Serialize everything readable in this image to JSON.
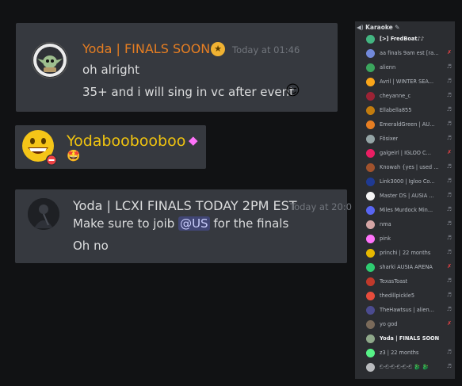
{
  "messages": [
    {
      "author": "Yoda | FINALS SOON",
      "badge": "★",
      "timestamp": "Today at 01:46",
      "lines": [
        "oh alright",
        "35+ and i will sing in vc after event"
      ],
      "emoji": "😏",
      "name_color": "#e67e22"
    },
    {
      "author": "Yodaboobooboo",
      "badge": "◆",
      "emoji_line": "🤩",
      "name_color": "#f1c40f"
    },
    {
      "author": "Yoda | LCXI FINALS TODAY 2PM EST",
      "timestamp": "Today at 20:0",
      "line1_prefix": "Make sure to joib ",
      "mention": "@US",
      "line1_suffix": " for the finals",
      "line2": "Oh no",
      "name_color": "#dcddde"
    }
  ],
  "voice_channel": {
    "name": "Karaoke",
    "icon": "speaker-icon",
    "members": [
      {
        "name": "[>] FredBoat♪♪",
        "color": "#43b581",
        "status": "",
        "highlight": true
      },
      {
        "name": "aa finals 9am est [ra...",
        "color": "#7289da",
        "status": "muted"
      },
      {
        "name": "alienn",
        "color": "#3ba55d",
        "status": "deafened"
      },
      {
        "name": "Avril | WINTER SEA...",
        "color": "#faa61a",
        "status": "deafened"
      },
      {
        "name": "cheyanne_c",
        "color": "#9b2335",
        "status": "deafened"
      },
      {
        "name": "Ellabella855",
        "color": "#c27c0e",
        "status": "deafened"
      },
      {
        "name": "EmeraldGreen | AU...",
        "color": "#e67e22",
        "status": "deafened"
      },
      {
        "name": "Fösixer",
        "color": "#95a5a6",
        "status": "deafened"
      },
      {
        "name": "galgeirl | IGLOO C...",
        "color": "#e91e63",
        "status": "muted"
      },
      {
        "name": "Knowah {yes | used ...",
        "color": "#a0522d",
        "status": "deafened"
      },
      {
        "name": "Link3000 | Igloo Co...",
        "color": "#1f3a93",
        "status": "deafened"
      },
      {
        "name": "Master DS | AUSIA ...",
        "color": "#f4f4f4",
        "status": "deafened"
      },
      {
        "name": "Miles Murdock Min...",
        "color": "#5865f2",
        "status": "deafened"
      },
      {
        "name": "nma",
        "color": "#d4a5a5",
        "status": "deafened"
      },
      {
        "name": "pink",
        "color": "#ff73fa",
        "status": "deafened"
      },
      {
        "name": "princhi | 22 months",
        "color": "#e6b800",
        "status": "deafened"
      },
      {
        "name": "sharki AUSIA ARENA",
        "color": "#2ecc71",
        "status": "muted"
      },
      {
        "name": "TexasToast",
        "color": "#c0392b",
        "status": "deafened"
      },
      {
        "name": "thedillpickle5",
        "color": "#e74c3c",
        "status": "deafened"
      },
      {
        "name": "TheHawtsus | alien...",
        "color": "#4b4b8f",
        "status": "deafened"
      },
      {
        "name": "yo god",
        "color": "#7a6a5a",
        "status": "muted"
      },
      {
        "name": "Yoda | FINALS SOON",
        "color": "#8fa88a",
        "status": "",
        "highlight": true
      },
      {
        "name": "z3 | 22 months",
        "color": "#57f287",
        "status": "deafened"
      },
      {
        "name": "ඞ-ඞ-ඞ-ඞ-ඞ-ඞ 🐉 🐉",
        "color": "#b9bbbe",
        "status": "deafened"
      }
    ]
  }
}
